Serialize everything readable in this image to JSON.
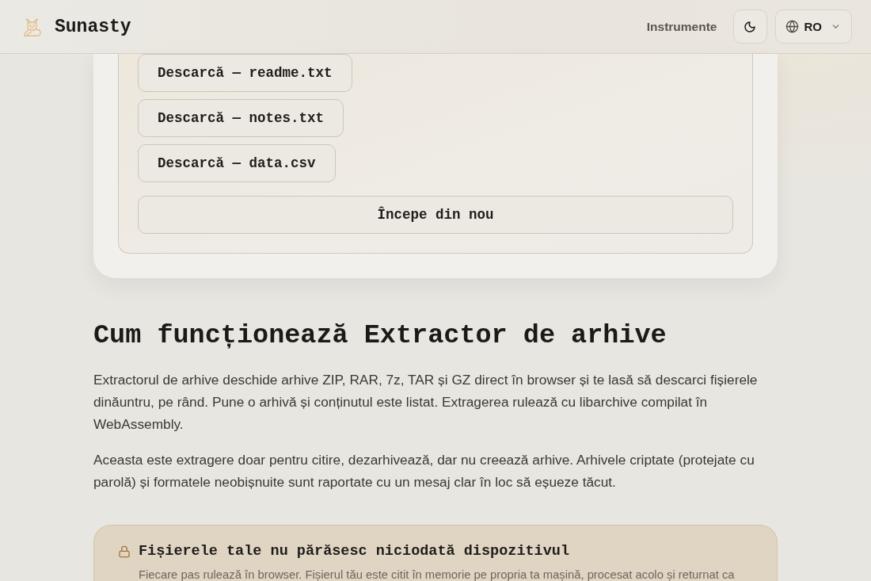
{
  "header": {
    "brand": "Sunasty",
    "nav_link": "Instrumente",
    "language": "RO"
  },
  "downloads": [
    "Descarcă — readme.txt",
    "Descarcă — notes.txt",
    "Descarcă — data.csv"
  ],
  "restart_button": "Începe din nou",
  "section": {
    "heading": "Cum funcționează Extractor de arhive",
    "paragraphs": [
      "Extractorul de arhive deschide arhive ZIP, RAR, 7z, TAR și GZ direct în browser și te lasă să descarci fișierele dinăuntru, pe rând. Pune o arhivă și conținutul este listat. Extragerea rulează cu libarchive compilat în WebAssembly.",
      "Aceasta este extragere doar pentru citire, dezarhivează, dar nu creează arhive. Arhivele criptate (protejate cu parolă) și formatele neobișnuite sunt raportate cu un mesaj clar în loc să eșueze tăcut."
    ]
  },
  "privacy_note": {
    "title": "Fișierele tale nu părăsesc niciodată dispozitivul",
    "text": "Fiecare pas rulează în browser. Fișierul tău este citit în memorie pe propria ta mașină, procesat acolo și returnat ca"
  }
}
